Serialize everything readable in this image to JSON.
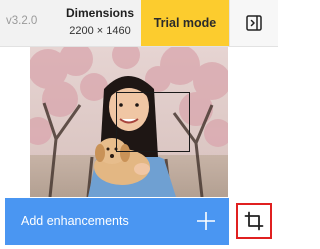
{
  "app": {
    "version": "v3.2.0"
  },
  "dimensions": {
    "title": "Dimensions",
    "value": "2200 × 1460"
  },
  "trial": {
    "label": "Trial mode"
  },
  "toolbar": {
    "panel_toggle_icon": "sidebar-toggle-icon",
    "enhance_label": "Add enhancements",
    "enhance_icon": "plus-icon",
    "crop_icon": "crop-icon"
  },
  "colors": {
    "trial_bg": "#fccc2e",
    "enhance_bg": "#4a96f2",
    "crop_highlight": "#e02020"
  }
}
